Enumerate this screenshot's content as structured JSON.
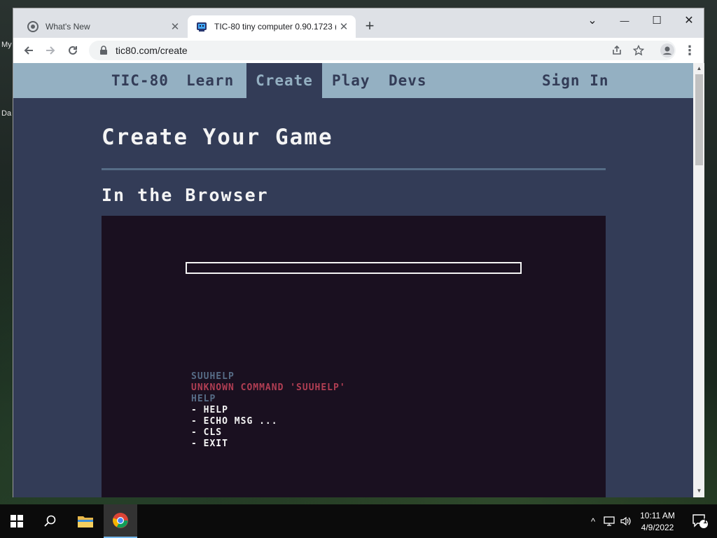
{
  "desktop": {
    "labels": [
      "My",
      "Da"
    ]
  },
  "browser": {
    "tabs": [
      {
        "title": "What's New",
        "close": "✕"
      },
      {
        "title": "TIC-80 tiny computer 0.90.1723 (",
        "close": "✕"
      }
    ],
    "new_tab_symbol": "+",
    "window_controls": {
      "menu": "⌄",
      "minimize": "—",
      "maximize": "☐",
      "close": "✕"
    },
    "url": "tic80.com/create"
  },
  "site": {
    "nav": {
      "items": [
        "TIC-80",
        "Learn",
        "Create",
        "Play",
        "Devs"
      ],
      "active": "Create",
      "sign_in": "Sign In"
    },
    "heading": "Create Your Game",
    "subheading": "In the Browser",
    "console": [
      {
        "text": "SUUHELP",
        "color": "#566c86"
      },
      {
        "text": "UNKNOWN COMMAND 'SUUHELP'",
        "color": "#b13e53"
      },
      {
        "text": "HELP",
        "color": "#566c86"
      },
      {
        "text": "- HELP",
        "color": "#f4f4f4"
      },
      {
        "text": "- ECHO MSG ...",
        "color": "#f4f4f4"
      },
      {
        "text": "- CLS",
        "color": "#f4f4f4"
      },
      {
        "text": "- EXIT",
        "color": "#f4f4f4"
      }
    ]
  },
  "taskbar": {
    "time": "10:11 AM",
    "date": "4/9/2022",
    "notification_count": "1"
  },
  "colors": {
    "page_bg": "#333c57",
    "nav_bg": "#94b0c2",
    "screen_bg": "#1a1020",
    "accent_red": "#b13e53"
  }
}
